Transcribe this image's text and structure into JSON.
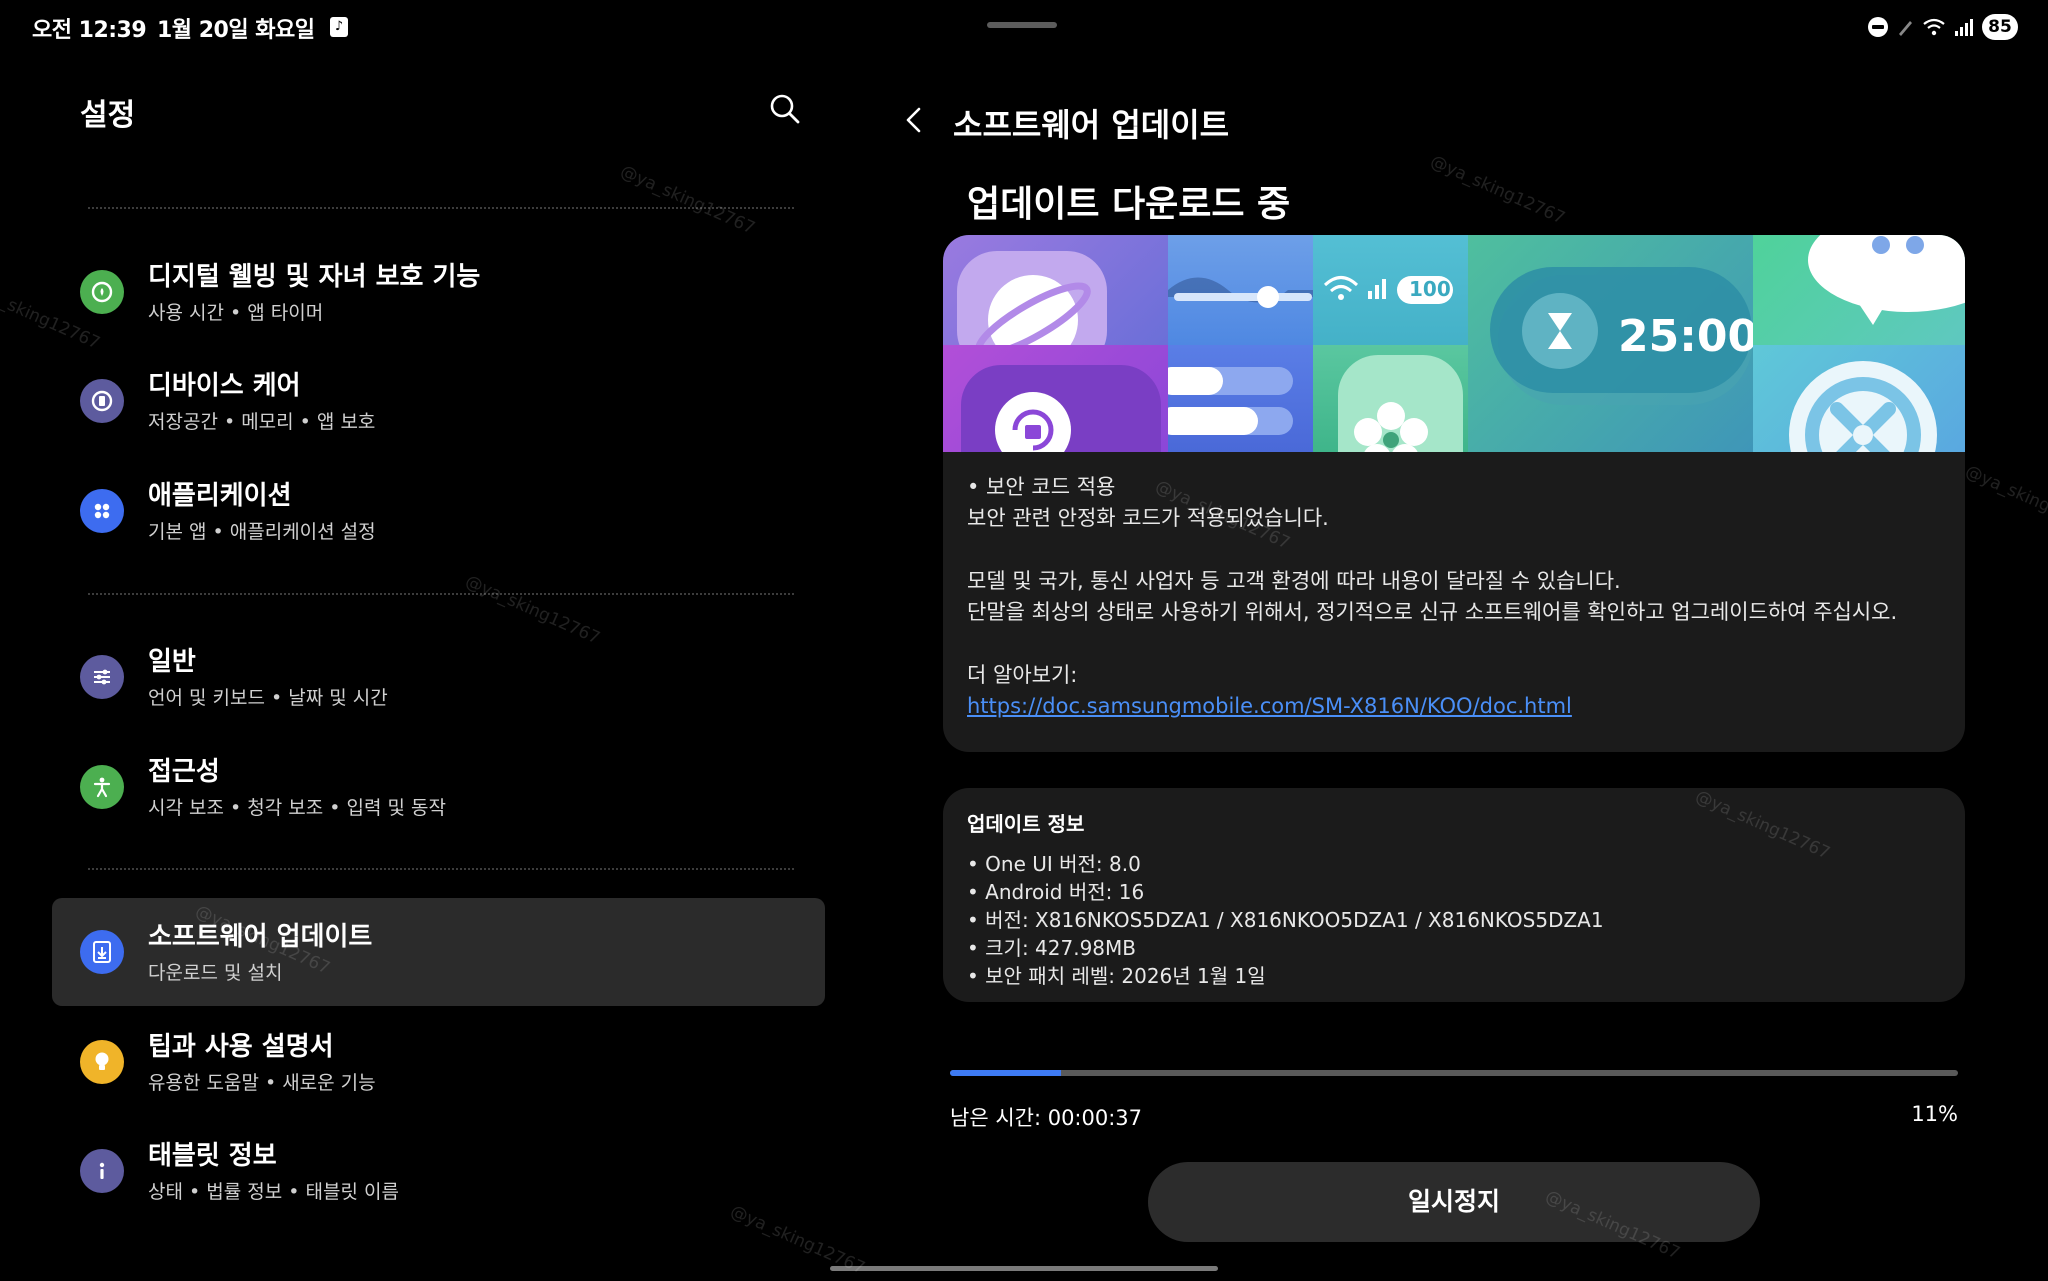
{
  "status_bar": {
    "time": "오전 12:39",
    "date": "1월 20일 화요일",
    "battery": "85"
  },
  "settings": {
    "title": "설정",
    "items": [
      {
        "title": "디지털 웰빙 및 자녀 보호 기능",
        "subtitle": "사용 시간 • 앱 타이머",
        "icon": "digital-wellbeing-icon",
        "color": "#4caf50"
      },
      {
        "title": "디바이스 케어",
        "subtitle": "저장공간 • 메모리 • 앱 보호",
        "icon": "device-care-icon",
        "color": "#5d5b9e"
      },
      {
        "title": "애플리케이션",
        "subtitle": "기본 앱 • 애플리케이션 설정",
        "icon": "apps-icon",
        "color": "#3d6cf0"
      },
      {
        "title": "일반",
        "subtitle": "언어 및 키보드 • 날짜 및 시간",
        "icon": "general-settings-icon",
        "color": "#5d5b9e"
      },
      {
        "title": "접근성",
        "subtitle": "시각 보조 • 청각 보조 • 입력 및 동작",
        "icon": "accessibility-icon",
        "color": "#4caf50"
      },
      {
        "title": "소프트웨어 업데이트",
        "subtitle": "다운로드 및 설치",
        "icon": "software-update-icon",
        "color": "#3d6cf0",
        "selected": true
      },
      {
        "title": "팁과 사용 설명서",
        "subtitle": "유용한 도움말 • 새로운 기능",
        "icon": "tips-icon",
        "color": "#f0b429"
      },
      {
        "title": "태블릿 정보",
        "subtitle": "상태 • 법률 정보 • 태블릿 이름",
        "icon": "info-icon",
        "color": "#5d5b9e"
      }
    ]
  },
  "update": {
    "header": "소프트웨어 업데이트",
    "section_title": "업데이트 다운로드 중",
    "banner_timer": "25:00",
    "banner_battery": "100",
    "notes": {
      "bullet": "• 보안 코드 적용",
      "line1": "보안 관련 안정화 코드가 적용되었습니다.",
      "line2": "모델 및 국가, 통신 사업자 등 고객 환경에 따라 내용이 달라질 수 있습니다.",
      "line3": "단말을 최상의 상태로 사용하기 위해서, 정기적으로 신규 소프트웨어를 확인하고 업그레이드하여 주십시오.",
      "more_label": "더 알아보기:",
      "link": "https://doc.samsungmobile.com/SM-X816N/KOO/doc.html"
    },
    "info": {
      "title": "업데이트 정보",
      "items": [
        "• One UI 버전: 8.0",
        "• Android 버전: 16",
        "• 버전: X816NKOS5DZA1 / X816NKOO5DZA1 / X816NKOS5DZA1",
        "• 크기: 427.98MB",
        "• 보안 패치 레벨: 2026년 1월 1일"
      ]
    },
    "progress_fraction": 0.11,
    "remaining": "남은 시간: 00:00:37",
    "percent": "11%",
    "pause_label": "일시정지"
  },
  "watermark": "@ya_sking12767",
  "colors": {
    "accent": "#3e7bf4",
    "link": "#4a8ff7",
    "card_bg": "#1b1b1b",
    "selected_bg": "#2b2b2b"
  }
}
